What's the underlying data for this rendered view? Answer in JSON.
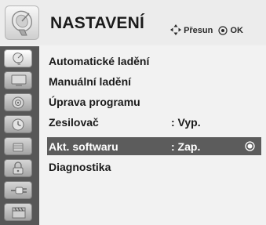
{
  "header": {
    "title": "NASTAVENÍ",
    "hint_move": "Přesun",
    "hint_ok": "OK"
  },
  "sidebar": {
    "items": [
      {
        "icon": "satellite-dish-icon",
        "active": true
      },
      {
        "icon": "tv-screen-icon"
      },
      {
        "icon": "speaker-icon"
      },
      {
        "icon": "clock-icon"
      },
      {
        "icon": "lock-icon"
      },
      {
        "icon": "options-lock-icon"
      },
      {
        "icon": "input-plug-icon"
      },
      {
        "icon": "film-clapper-icon"
      }
    ]
  },
  "menu": {
    "items": [
      {
        "label": "Automatické ladění",
        "value": ""
      },
      {
        "label": "Manuální ladění",
        "value": ""
      },
      {
        "label": "Úprava programu",
        "value": ""
      },
      {
        "label": "Zesilovač",
        "value": ": Vyp."
      },
      {
        "label": "Akt. softwaru",
        "value": ": Zap.",
        "selected": true
      },
      {
        "label": "Diagnostika",
        "value": ""
      }
    ]
  },
  "colors": {
    "sidebar_bg": "#575757",
    "selected_row_bg": "#5c5c5c",
    "menu_bg": "#f2f2f2"
  }
}
